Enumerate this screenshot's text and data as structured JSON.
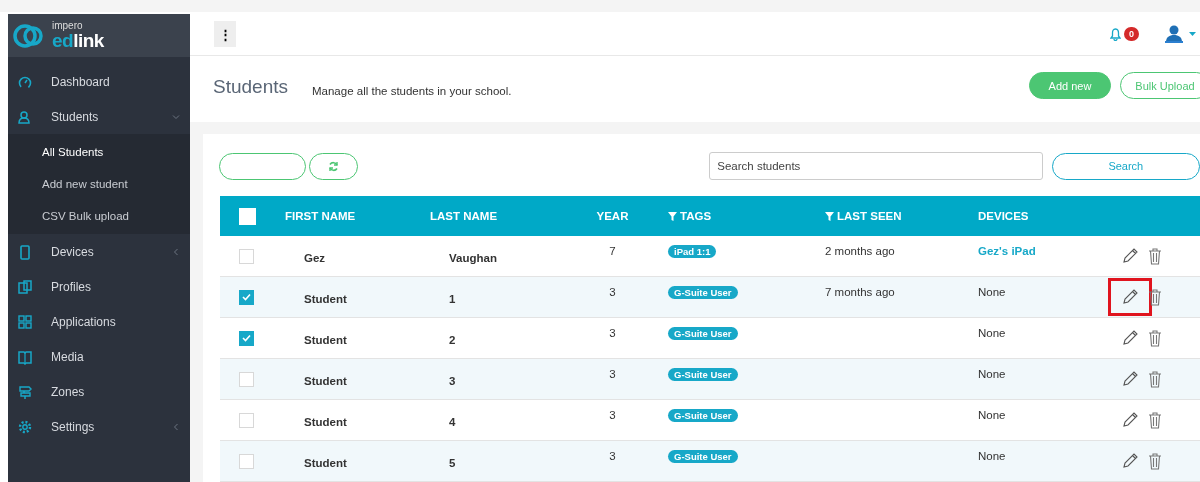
{
  "brand": {
    "small": "impero",
    "name_part1": "ed",
    "name_part2": "link"
  },
  "sidebar": {
    "items": [
      {
        "label": "Dashboard"
      },
      {
        "label": "Students",
        "expanded": true,
        "children": [
          {
            "label": "All Students",
            "selected": true
          },
          {
            "label": "Add new student",
            "selected": false
          },
          {
            "label": "CSV Bulk upload",
            "selected": false
          }
        ]
      },
      {
        "label": "Devices",
        "expanded": false
      },
      {
        "label": "Profiles"
      },
      {
        "label": "Applications"
      },
      {
        "label": "Media"
      },
      {
        "label": "Zones"
      },
      {
        "label": "Settings",
        "expanded": false
      }
    ]
  },
  "topbar": {
    "menu_glyph": "⋮",
    "notifications": "0"
  },
  "page": {
    "title": "Students",
    "subtitle": "Manage all the students in your school.",
    "buttons": [
      {
        "label": "Add new",
        "kind": "primary"
      },
      {
        "label": "Bulk Upload",
        "kind": "outline"
      }
    ]
  },
  "toolbar": {
    "search": {
      "placeholder": "Search students"
    },
    "search_button": "Search"
  },
  "table": {
    "all_checked": false,
    "columns": [
      {
        "label": "FIRST NAME",
        "filter": false
      },
      {
        "label": "LAST NAME",
        "filter": false
      },
      {
        "label": "YEAR",
        "filter": false
      },
      {
        "label": "TAGS",
        "filter": true
      },
      {
        "label": "LAST SEEN",
        "filter": true
      },
      {
        "label": "DEVICES",
        "filter": false
      }
    ],
    "rows": [
      {
        "checked": false,
        "first": "Gez",
        "last": "Vaughan",
        "year": "7",
        "tag": "iPad 1:1",
        "last_seen": "2 months ago",
        "device": "Gez's iPad",
        "device_link": true,
        "highlighted": false
      },
      {
        "checked": true,
        "first": "Student",
        "last": "1",
        "year": "3",
        "tag": "G-Suite User",
        "last_seen": "7 months ago",
        "device": "None",
        "device_link": false,
        "highlighted": true
      },
      {
        "checked": true,
        "first": "Student",
        "last": "2",
        "year": "3",
        "tag": "G-Suite User",
        "device": "None",
        "device_link": false,
        "highlighted": false
      },
      {
        "checked": false,
        "first": "Student",
        "last": "3",
        "year": "3",
        "tag": "G-Suite User",
        "device": "None",
        "device_link": false,
        "highlighted": false
      },
      {
        "checked": false,
        "first": "Student",
        "last": "4",
        "year": "3",
        "tag": "G-Suite User",
        "device": "None",
        "device_link": false,
        "highlighted": false
      },
      {
        "checked": false,
        "first": "Student",
        "last": "5",
        "year": "3",
        "tag": "G-Suite User",
        "device": "None",
        "device_link": false,
        "highlighted": false
      }
    ]
  }
}
